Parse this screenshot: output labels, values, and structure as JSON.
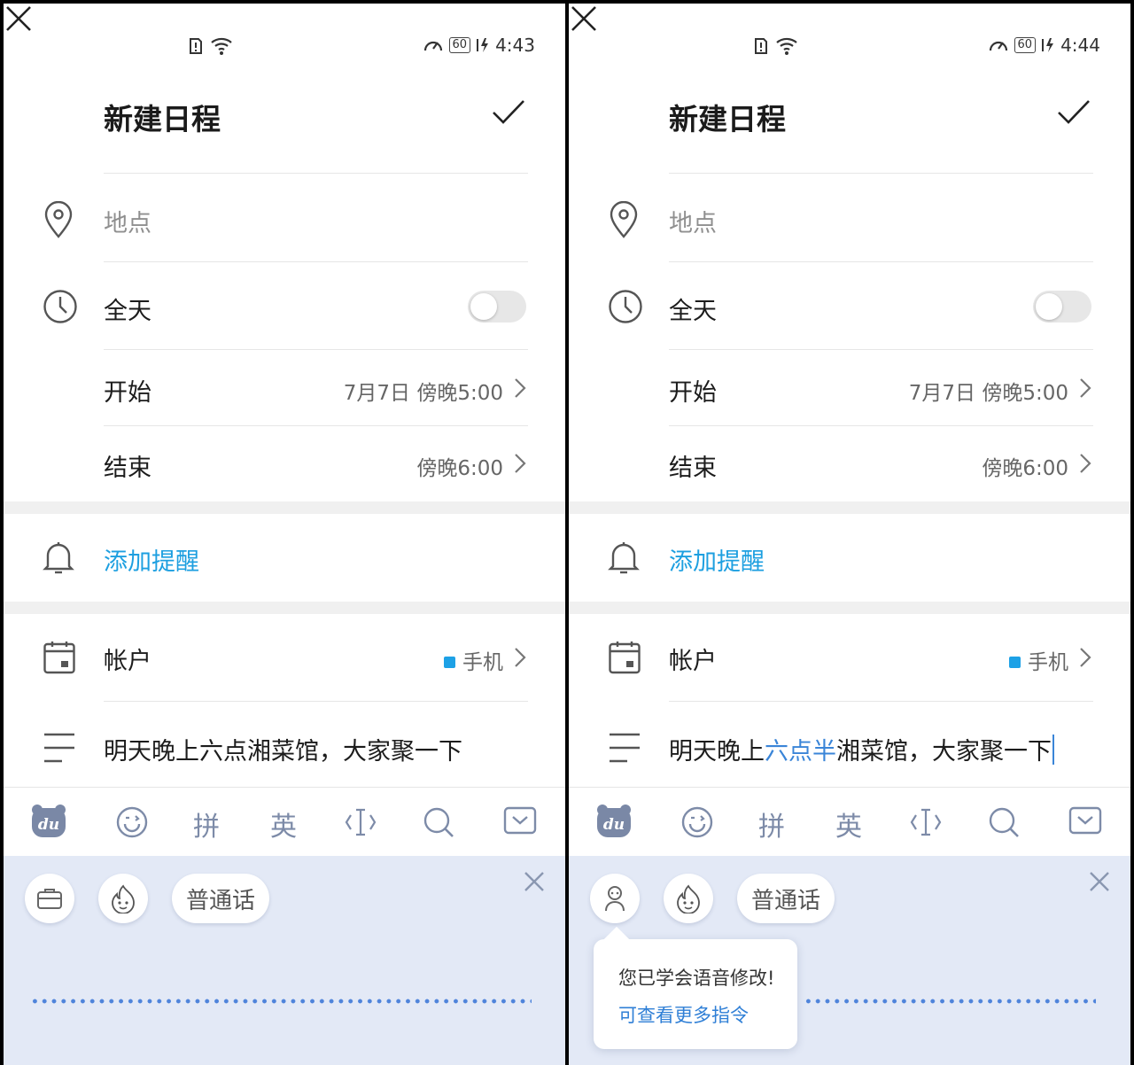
{
  "screens": [
    {
      "status": {
        "time": "4:43",
        "battery": "60"
      },
      "header": {
        "title": "新建日程"
      },
      "location": {
        "placeholder": "地点"
      },
      "all_day": {
        "label": "全天"
      },
      "start": {
        "label": "开始",
        "value": "7月7日 傍晚5:00"
      },
      "end": {
        "label": "结束",
        "value": "傍晚6:00"
      },
      "reminder": {
        "label": "添加提醒"
      },
      "account": {
        "label": "帐户",
        "value": "手机"
      },
      "note": {
        "before": "明天晚上六点湘菜馆，大家聚一下",
        "highlight": "",
        "after": ""
      },
      "keyboard": {
        "items": [
          "拼",
          "英"
        ]
      },
      "voice": {
        "dialect": "普通话",
        "tip": null
      }
    },
    {
      "status": {
        "time": "4:44",
        "battery": "60"
      },
      "header": {
        "title": "新建日程"
      },
      "location": {
        "placeholder": "地点"
      },
      "all_day": {
        "label": "全天"
      },
      "start": {
        "label": "开始",
        "value": "7月7日 傍晚5:00"
      },
      "end": {
        "label": "结束",
        "value": "傍晚6:00"
      },
      "reminder": {
        "label": "添加提醒"
      },
      "account": {
        "label": "帐户",
        "value": "手机"
      },
      "note": {
        "before": "明天晚上",
        "highlight": "六点半",
        "after": "湘菜馆，大家聚一下"
      },
      "keyboard": {
        "items": [
          "拼",
          "英"
        ]
      },
      "voice": {
        "dialect": "普通话",
        "tip": {
          "line1": "您已学会语音修改!",
          "line2": "可查看更多指令"
        }
      }
    }
  ],
  "colors": {
    "accent": "#1d9fe0",
    "voice_bg": "#e3e9f6",
    "wave": "#4f84db"
  }
}
